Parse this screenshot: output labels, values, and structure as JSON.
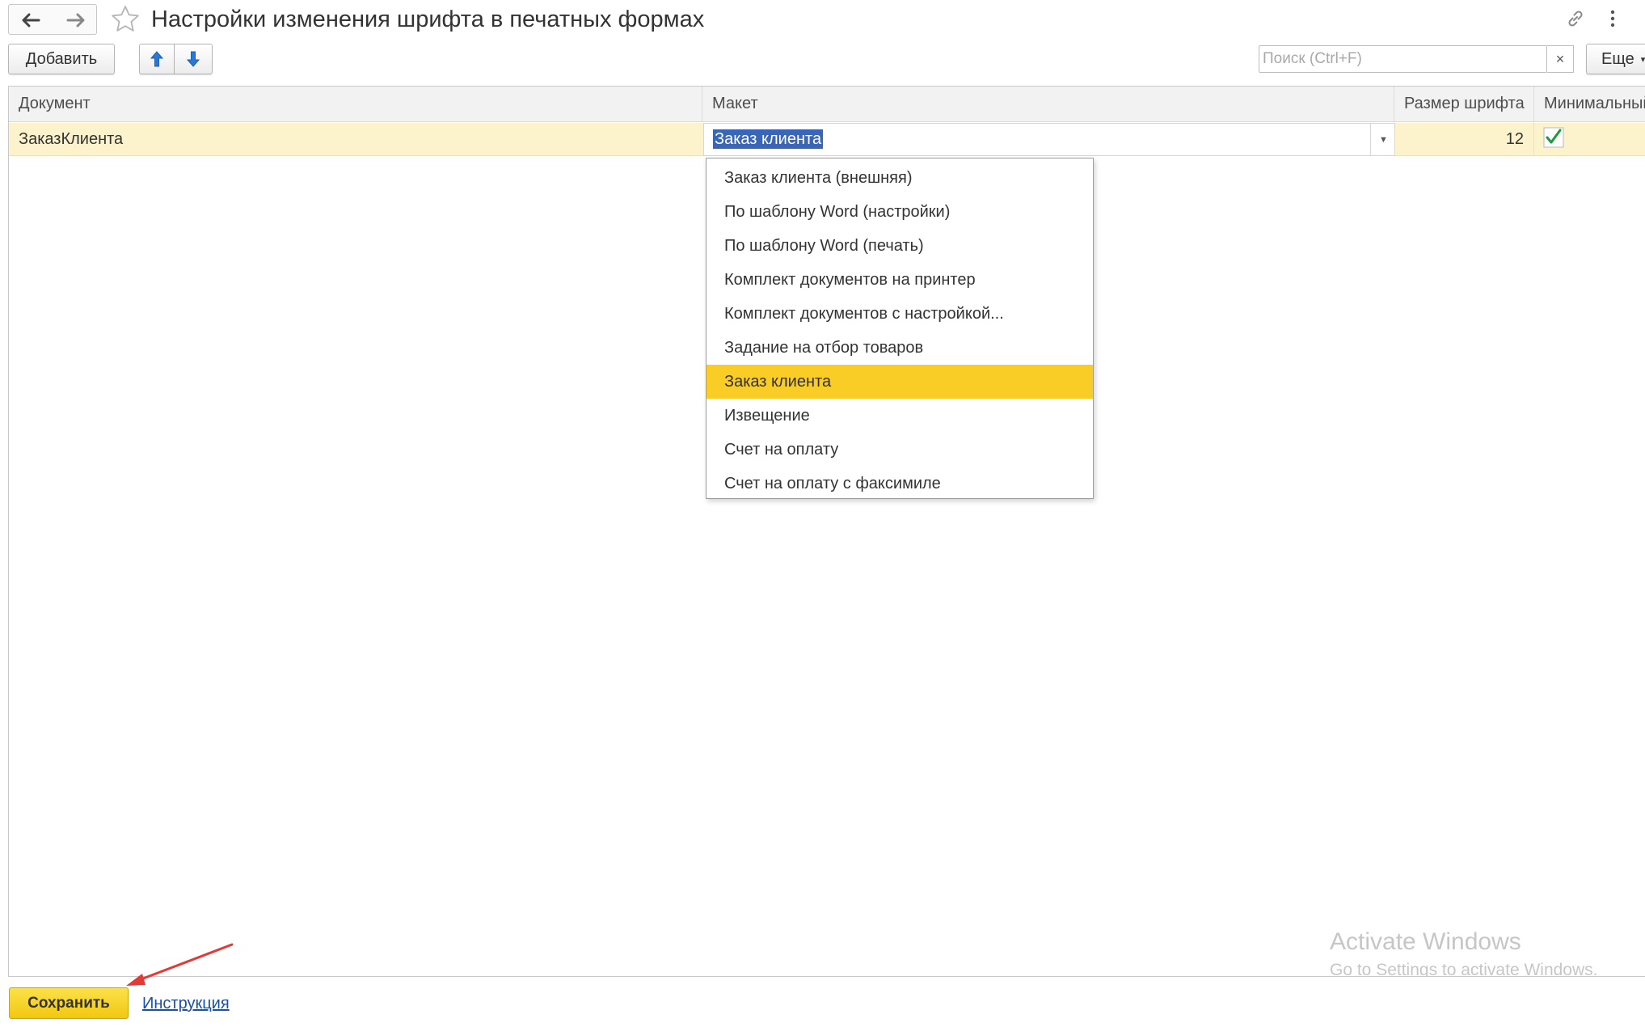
{
  "header": {
    "title": "Настройки изменения шрифта в печатных формах"
  },
  "toolbar": {
    "add_label": "Добавить",
    "search_placeholder": "Поиск (Ctrl+F)",
    "search_clear": "×",
    "more_label": "Еще"
  },
  "table": {
    "columns": [
      "Документ",
      "Макет",
      "Размер шрифта",
      "Минимальный"
    ],
    "rows": [
      {
        "document": "ЗаказКлиента",
        "layout": "Заказ клиента",
        "font_size": "12",
        "minimal": true
      }
    ]
  },
  "dropdown": {
    "options": [
      "Заказ клиента (внешняя)",
      "По шаблону Word (настройки)",
      "По шаблону Word (печать)",
      "Комплект документов на принтер",
      "Комплект документов с настройкой...",
      "Задание на отбор товаров",
      "Заказ клиента",
      "Извещение",
      "Счет на оплату",
      "Счет на оплату с факсимиле"
    ],
    "selected_index": 6
  },
  "footer": {
    "save_label": "Сохранить",
    "instruction_link": "Инструкция"
  },
  "watermark": {
    "line1": "Activate Windows",
    "line2": "Go to Settings to activate Windows."
  },
  "colors": {
    "accent_yellow": "#f9cc26",
    "row_highlight": "#fcf3cc",
    "text_selection": "#3a66b8",
    "checkmark": "#1a9b3c",
    "arrow_blue": "#2a77d6",
    "annotation_red": "#e53935"
  },
  "icons": {
    "back": "arrow-left-icon",
    "forward": "arrow-right-icon",
    "favorite": "star-icon",
    "link": "link-icon",
    "menu": "more-vertical-icon",
    "move_up": "arrow-up-icon",
    "move_down": "arrow-down-icon",
    "check": "checkmark-icon"
  }
}
